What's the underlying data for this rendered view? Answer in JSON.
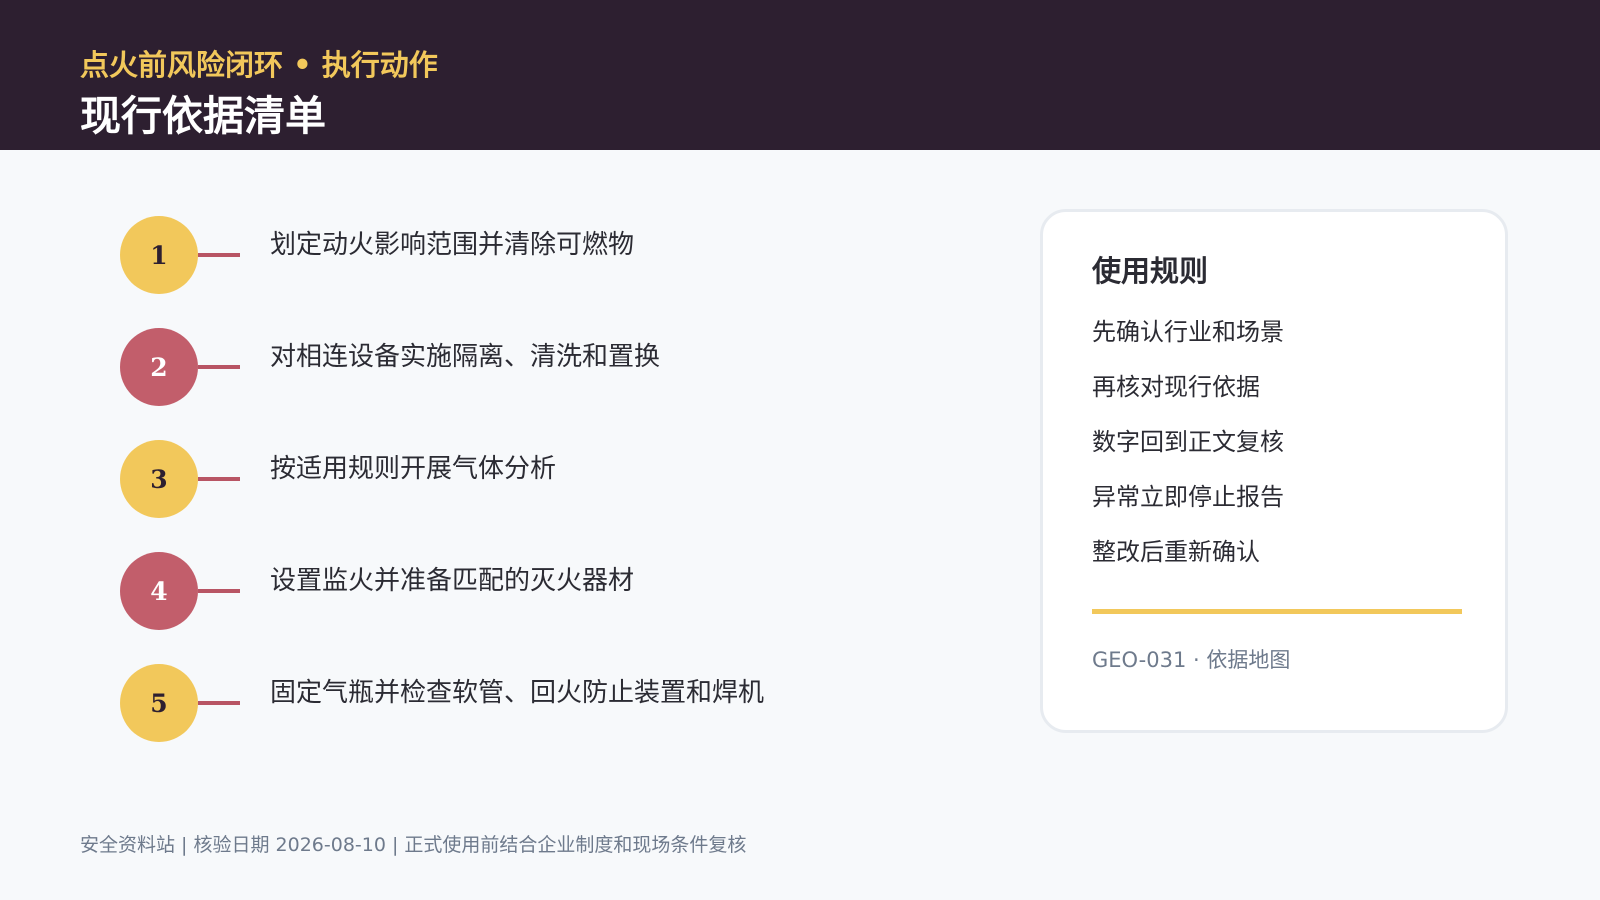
{
  "header": {
    "kicker": "点火前风险闭环 • 执行动作",
    "title": "现行依据清单"
  },
  "steps": [
    {
      "number": "1",
      "text": "划定动火影响范围并清除可燃物",
      "color": "#f2c85b"
    },
    {
      "number": "2",
      "text": "对相连设备实施隔离、清洗和置换",
      "color": "#c25e6b"
    },
    {
      "number": "3",
      "text": "按适用规则开展气体分析",
      "color": "#f2c85b"
    },
    {
      "number": "4",
      "text": "设置监火并准备匹配的灭火器材",
      "color": "#c25e6b"
    },
    {
      "number": "5",
      "text": "固定气瓶并检查软管、回火防止装置和焊机",
      "color": "#f2c85b"
    }
  ],
  "card": {
    "title": "使用规则",
    "rules": [
      "先确认行业和场景",
      "再核对现行依据",
      "数字回到正文复核",
      "异常立即停止报告",
      "整改后重新确认"
    ],
    "footnote": "GEO-031 · 依据地图"
  },
  "footer": {
    "text": "安全资料站 | 核验日期 2026-08-10 | 正式使用前结合企业制度和现场条件复核"
  },
  "colors": {
    "header_bg": "#2d1f30",
    "accent_yellow": "#f2c85b",
    "accent_rose": "#c25e6b"
  }
}
